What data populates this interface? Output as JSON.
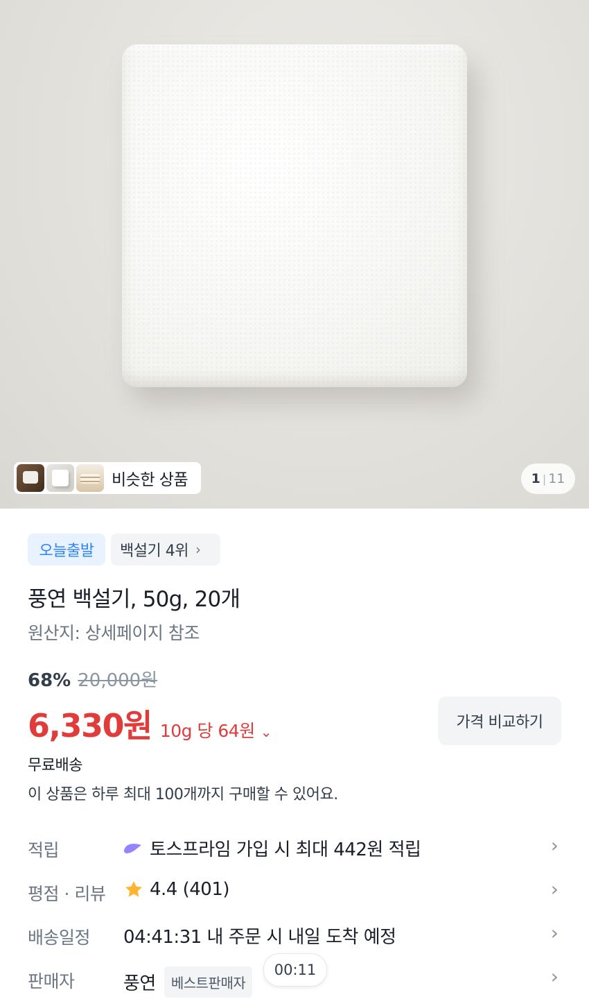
{
  "gallery": {
    "similar_label": "비슷한 상품",
    "pager_current": "1",
    "pager_separator": "|",
    "pager_total": "11"
  },
  "tags": {
    "today_ship": "오늘출발",
    "rank": "백설기 4위",
    "rank_chevron": "›"
  },
  "product": {
    "title": "풍연 백설기, 50g, 20개",
    "origin": "원산지: 상세페이지 참조"
  },
  "pricing": {
    "discount": "68%",
    "original_price": "20,000원",
    "price": "6,330원",
    "unit_price": "10g 당 64원",
    "unit_chevron": "⌄",
    "compare_button": "가격 비교하기",
    "price_color": "#e13c3c"
  },
  "shipping": {
    "free_shipping": "무료배송",
    "limit_notice": "이 상품은 하루 최대 100개까지 구매할 수 있어요."
  },
  "info_rows": [
    {
      "label": "적립",
      "value": "토스프라임 가입 시 최대 442원 적립",
      "icon": "toss-prime-icon"
    },
    {
      "label": "평점 · 리뷰",
      "value": "4.4 (401)",
      "icon": "star-icon"
    },
    {
      "label": "배송일정",
      "value": "04:41:31 내 주문 시 내일 도착 예정"
    },
    {
      "label": "판매자",
      "value": "풍연",
      "badge": "베스트판매자"
    }
  ],
  "chevron": "›",
  "timer_bubble": "00:11"
}
